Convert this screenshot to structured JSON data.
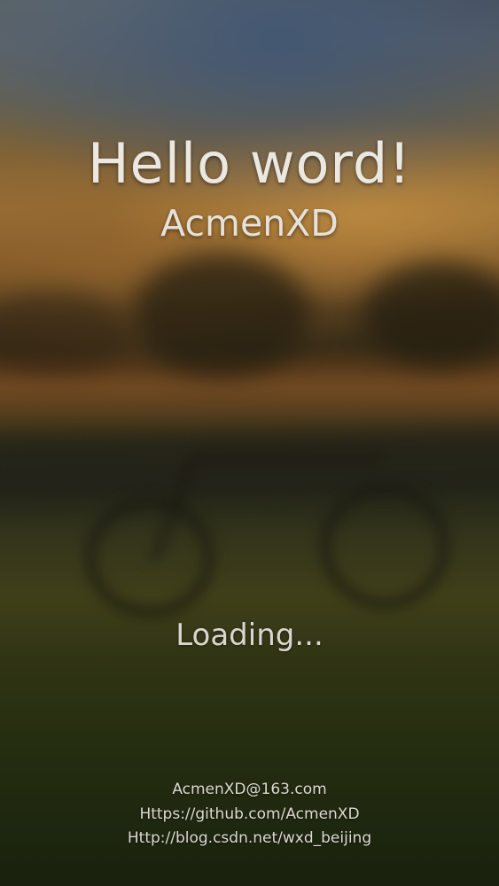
{
  "splash": {
    "title": "Hello word!",
    "subtitle": "AcmenXD",
    "status": "Loading..."
  },
  "footer": {
    "email": "AcmenXD@163.com",
    "github": "Https://github.com/AcmenXD",
    "blog": "Http://blog.csdn.net/wxd_beijing"
  },
  "colors": {
    "text": "#ebe8e2",
    "sky": "#5b6068",
    "sunset": "#a67a3a",
    "grass": "#2f3a14"
  }
}
